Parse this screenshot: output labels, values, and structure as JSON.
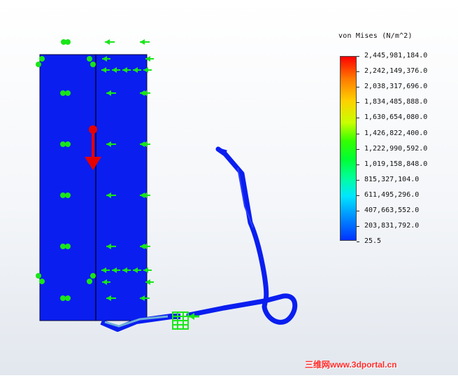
{
  "legend": {
    "title": "von Mises (N/m^2)",
    "values": [
      "2,445,981,184.0",
      "2,242,149,376.0",
      "2,038,317,696.0",
      "1,834,485,888.0",
      "1,630,654,080.0",
      "1,426,822,400.0",
      "1,222,990,592.0",
      "1,019,158,848.0",
      "815,327,104.0",
      "611,495,296.0",
      "407,663,552.0",
      "203,831,792.0",
      "25.5"
    ]
  },
  "watermark": "三维网www.3dportal.cn",
  "colors": {
    "model_blue": "#0a1ef0",
    "model_edge": "#0a0a3a",
    "fixture_green": "#19e619",
    "load_red": "#e60000",
    "watermark_red": "#ff2a2a"
  },
  "icons": {
    "fixture": "green-arrow-icon",
    "load": "red-arrow-icon"
  }
}
